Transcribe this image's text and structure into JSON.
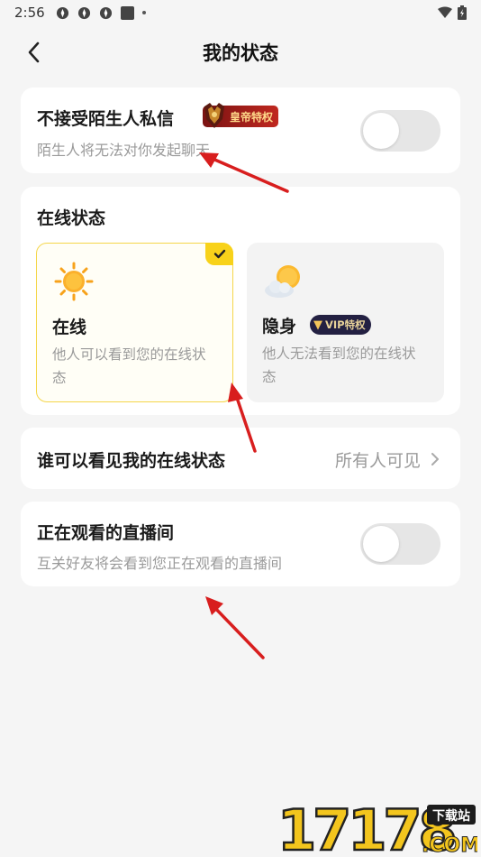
{
  "status_bar": {
    "time": "2:56"
  },
  "nav": {
    "title": "我的状态"
  },
  "stranger_dm": {
    "title": "不接受陌生人私信",
    "badge": "皇帝特权",
    "subtitle": "陌生人将无法对你发起聊天",
    "enabled": false
  },
  "online_status": {
    "title": "在线状态",
    "options": [
      {
        "name": "在线",
        "desc": "他人可以看到您的在线状态",
        "selected": true
      },
      {
        "name": "隐身",
        "desc": "他人无法看到您的在线状态",
        "selected": false,
        "badge": "VIP特权"
      }
    ]
  },
  "visibility": {
    "label": "谁可以看见我的在线状态",
    "value": "所有人可见"
  },
  "watching_live": {
    "title": "正在观看的直播间",
    "subtitle": "互关好友将会看到您正在观看的直播间",
    "enabled": false
  },
  "watermark": {
    "digits": "17178",
    "tag": "下载站",
    "suffix": ".COM"
  },
  "colors": {
    "accent": "#f8d21a",
    "arrow": "#d81e1e"
  }
}
